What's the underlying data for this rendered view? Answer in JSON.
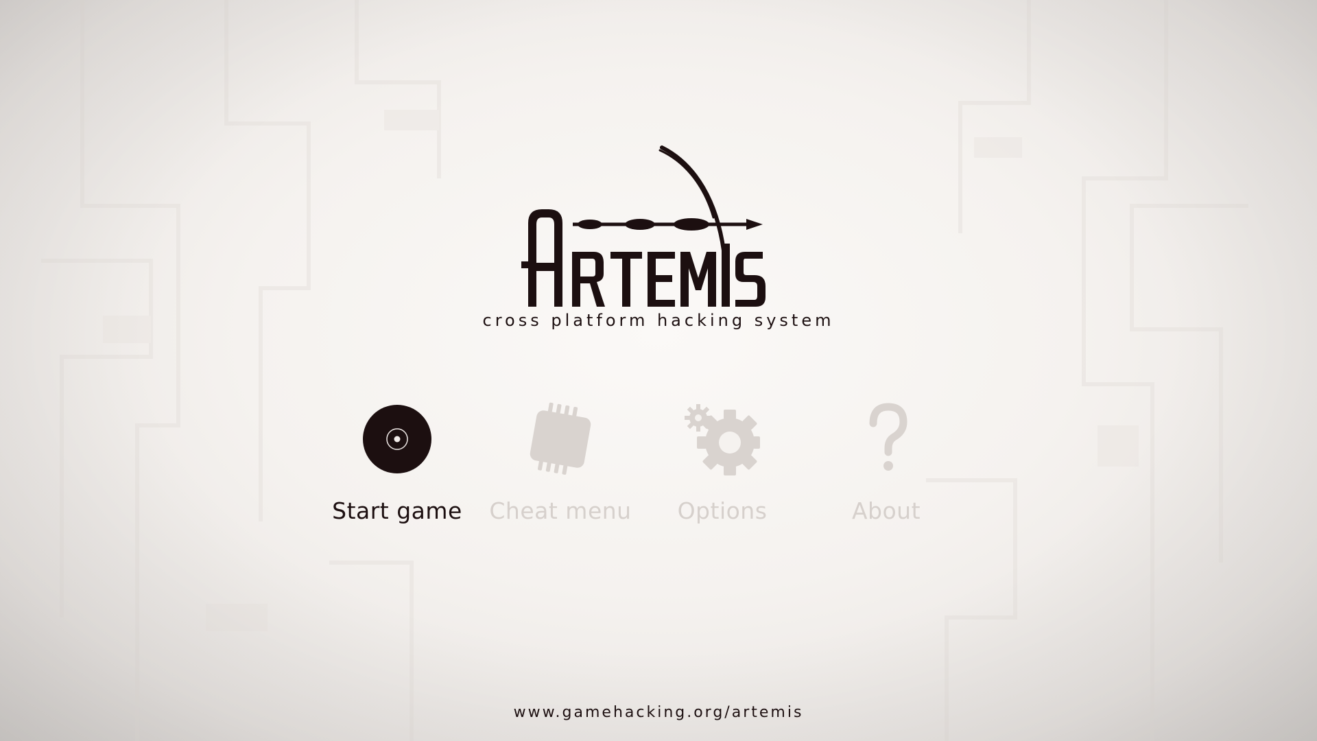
{
  "app": {
    "logo_text": "Artemis",
    "tagline": "cross platform hacking system"
  },
  "menu": {
    "items": [
      {
        "label": "Start game",
        "icon": "disc-icon",
        "state": "selected"
      },
      {
        "label": "Cheat menu",
        "icon": "chip-icon",
        "state": "unselected"
      },
      {
        "label": "Options",
        "icon": "gears-icon",
        "state": "unselected"
      },
      {
        "label": "About",
        "icon": "question-mark-icon",
        "state": "unselected"
      }
    ]
  },
  "footer": {
    "url": "www.gamehacking.org/artemis"
  },
  "colors": {
    "primary": "#1c0f10",
    "inactive": "#d6d0cc",
    "background": "#f5f2ef"
  }
}
